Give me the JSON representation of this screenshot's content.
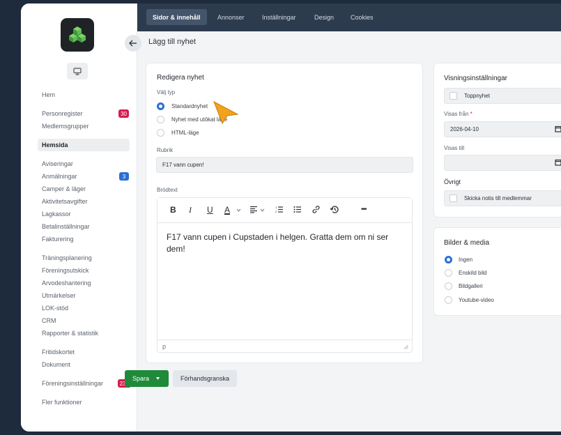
{
  "sidebar": {
    "items": [
      {
        "label": "Hem"
      },
      {
        "label": "Personregister",
        "badge": "30"
      },
      {
        "label": "Medlemsgrupper"
      },
      {
        "label": "Hemsida"
      },
      {
        "label": "Aviseringar"
      },
      {
        "label": "Anmälningar",
        "badge": "3"
      },
      {
        "label": "Camper & läger"
      },
      {
        "label": "Aktivitetsavgifter"
      },
      {
        "label": "Lagkassor"
      },
      {
        "label": "Betalinställningar"
      },
      {
        "label": "Fakturering"
      },
      {
        "label": "Träningsplanering"
      },
      {
        "label": "Föreningsutskick"
      },
      {
        "label": "Arvodeshantering"
      },
      {
        "label": "Utmärkelser"
      },
      {
        "label": "LOK-stöd"
      },
      {
        "label": "CRM"
      },
      {
        "label": "Rapporter & statistik"
      },
      {
        "label": "Fritidskortet"
      },
      {
        "label": "Dokument"
      },
      {
        "label": "Föreningsinställningar",
        "badge": "239"
      },
      {
        "label": "Fler funktioner"
      }
    ]
  },
  "topnav": {
    "tabs": [
      {
        "label": "Sidor & innehåll"
      },
      {
        "label": "Annonser"
      },
      {
        "label": "Inställningar"
      },
      {
        "label": "Design"
      },
      {
        "label": "Cookies"
      }
    ]
  },
  "page": {
    "title": "Lägg till nyhet"
  },
  "edit": {
    "heading": "Redigera nyhet",
    "type_label": "Välj typ",
    "types": [
      "Standardnyhet",
      "Nyhet med utökat läge",
      "HTML-läge"
    ],
    "headline_label": "Rubrik",
    "headline_value": "F17 vann cupen!",
    "body_label": "Brödtext",
    "body_text": "F17 vann cupen i Cupstaden i helgen. Gratta dem om ni ser dem!",
    "status_path": "p",
    "toolbar": {
      "bold": "B",
      "italic": "I",
      "underline": "U",
      "color": "A",
      "more": "•••"
    }
  },
  "display": {
    "heading": "Visningsinställningar",
    "top_news": "Toppnyhet",
    "from_label": "Visas från",
    "required_mark": "*",
    "from_value": "2026-04-10",
    "to_label": "Visas till",
    "to_value": "",
    "other_heading": "Övrigt",
    "notify": "Skicka notis till medlemmar"
  },
  "media": {
    "heading": "Bilder & media",
    "options": [
      "Ingen",
      "Enskild bild",
      "Bildgalleri",
      "Youtube-video"
    ]
  },
  "actions": {
    "save": "Spara",
    "preview": "Förhandsgranska"
  },
  "colors": {
    "accent": "#2a6fd6",
    "save": "#1f8a3a",
    "badge": "#d81b4f",
    "topbar": "#2d3b4e"
  }
}
